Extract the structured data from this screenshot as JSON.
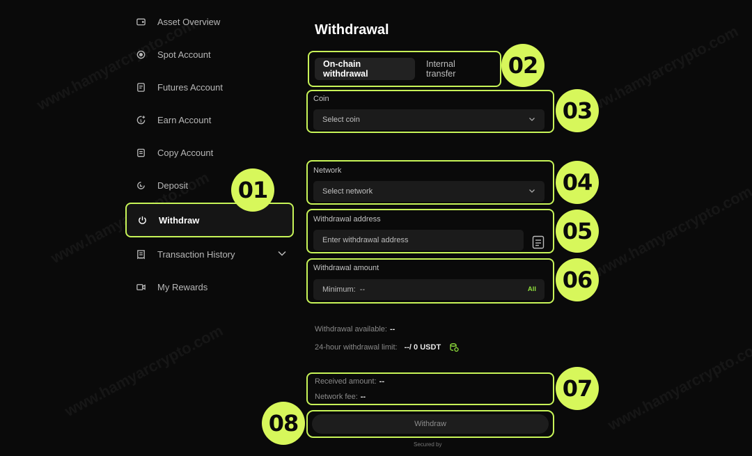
{
  "sidebar": {
    "items": [
      {
        "label": "Asset Overview"
      },
      {
        "label": "Spot Account"
      },
      {
        "label": "Futures Account"
      },
      {
        "label": "Earn Account"
      },
      {
        "label": "Copy Account"
      },
      {
        "label": "Deposit"
      },
      {
        "label": "Withdraw",
        "active": true
      },
      {
        "label": "Transaction History"
      },
      {
        "label": "My Rewards"
      }
    ]
  },
  "badges": [
    "01",
    "02",
    "03",
    "04",
    "05",
    "06",
    "07",
    "08"
  ],
  "page": {
    "title": "Withdrawal",
    "tabs": [
      {
        "label": "On-chain withdrawal",
        "active": true
      },
      {
        "label": "Internal transfer"
      }
    ],
    "coin": {
      "label": "Coin",
      "placeholder": "Select coin"
    },
    "network": {
      "label": "Network",
      "placeholder": "Select network"
    },
    "address": {
      "label": "Withdrawal address",
      "placeholder": "Enter withdrawal address"
    },
    "amount": {
      "label": "Withdrawal amount",
      "placeholder": "Minimum:  --",
      "all_label": "All"
    },
    "available": {
      "label": "Withdrawal available:",
      "value": "--"
    },
    "limit": {
      "label": "24-hour withdrawal limit:",
      "value": "--/ 0 USDT"
    },
    "received": {
      "label": "Received amount:",
      "value": "--"
    },
    "fee": {
      "label": "Network fee:",
      "value": "--"
    },
    "withdraw_button": "Withdraw",
    "secured_by": "Secured by"
  },
  "colors": {
    "accent": "#c8f558",
    "badge": "#d7f75b",
    "background": "#0a0a0a"
  }
}
